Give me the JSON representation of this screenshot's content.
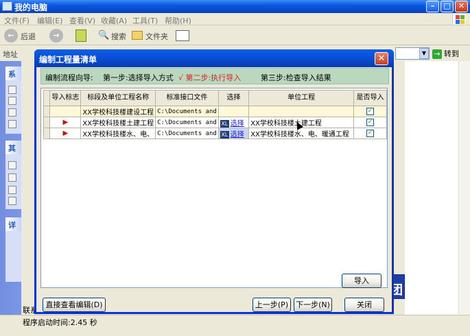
{
  "explorer": {
    "title": "我的电脑",
    "menu": [
      "文件(F)",
      "编辑(E)",
      "查看(V)",
      "收藏(A)",
      "工具(T)",
      "帮助(H)"
    ],
    "toolbar": {
      "back": "后退",
      "search": "搜索",
      "folders": "文件夹"
    },
    "address_label": "地址",
    "goto": "转到",
    "status": "程序启动时间:2.45 秒",
    "status_line_above": "联系"
  },
  "dialog": {
    "title": "编制工程量清单",
    "wizard": {
      "label": "编制流程向导:",
      "step1": "第一步:选择导入方式",
      "step2": "√ 第二步:执行导入",
      "step3": "第三步:检查导入结果"
    },
    "table": {
      "headers": [
        "导入标志",
        "标段及单位工程名称",
        "标准接口文件",
        "选择",
        "单位工程",
        "是否导入"
      ],
      "rows": [
        {
          "flag": "",
          "name": "XX学校科技楼建设工程",
          "file": "C:\\Documents and",
          "select": "",
          "unit": "",
          "import": true
        },
        {
          "flag": "flag",
          "name": "XX学校科技楼土建工程",
          "file": "C:\\Documents and",
          "select": "选择",
          "unit": "XX学校科技楼土建工程",
          "import": true
        },
        {
          "flag": "flag",
          "name": "XX学校科技楼水、电、",
          "file": "C:\\Documents and",
          "select": "选择",
          "unit": "XX学校科技楼水、电、暖通工程",
          "import": true
        }
      ]
    },
    "buttons": {
      "import": "导入",
      "direct_edit": "直接查看编辑(D)",
      "prev": "上一步(P)",
      "next": "下一步(N)",
      "close": "关闭"
    }
  }
}
